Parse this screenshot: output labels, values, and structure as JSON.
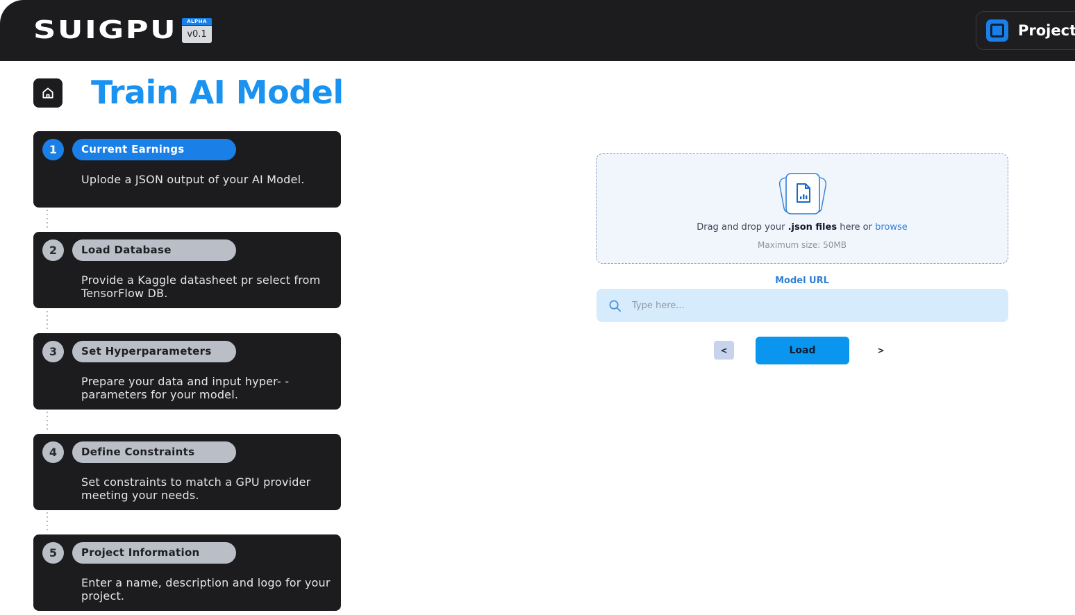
{
  "header": {
    "logo": "SUIGPU",
    "badge_alpha": "ALPHA",
    "version": "v0.1",
    "project_button": "Project",
    "project_icon": "project-square-icon"
  },
  "page": {
    "title": "Train AI Model",
    "home_icon": "home-icon"
  },
  "steps": [
    {
      "number": "1",
      "title": "Current Earnings",
      "description": "Uplode a JSON output of your AI Model.",
      "active": true
    },
    {
      "number": "2",
      "title": "Load Database",
      "description": "Provide a Kaggle datasheet pr select from TensorFlow DB.",
      "active": false
    },
    {
      "number": "3",
      "title": "Set Hyperparameters",
      "description": "Prepare your data and input hyper- -parameters for your model.",
      "active": false
    },
    {
      "number": "4",
      "title": "Define Constraints",
      "description": "Set constraints to match a GPU provider meeting your needs.",
      "active": false
    },
    {
      "number": "5",
      "title": "Project Information",
      "description": "Enter a name, description and logo for your project.",
      "active": false
    }
  ],
  "upload": {
    "text_prefix": "Drag and drop your",
    "text_bold": ".json files",
    "text_middle": "here or",
    "browse_link": "browse",
    "max_size": "Maximum size: 50MB",
    "icon": "file-chart-icon"
  },
  "model_url": {
    "label": "Model URL",
    "placeholder": "Type here...",
    "value": ""
  },
  "actions": {
    "prev": "<",
    "load": "Load",
    "next": ">"
  },
  "colors": {
    "accent": "#1a92f0",
    "dark": "#1c1c1e",
    "pill_inactive": "#b9bec7",
    "load_button": "#0a95ef"
  }
}
